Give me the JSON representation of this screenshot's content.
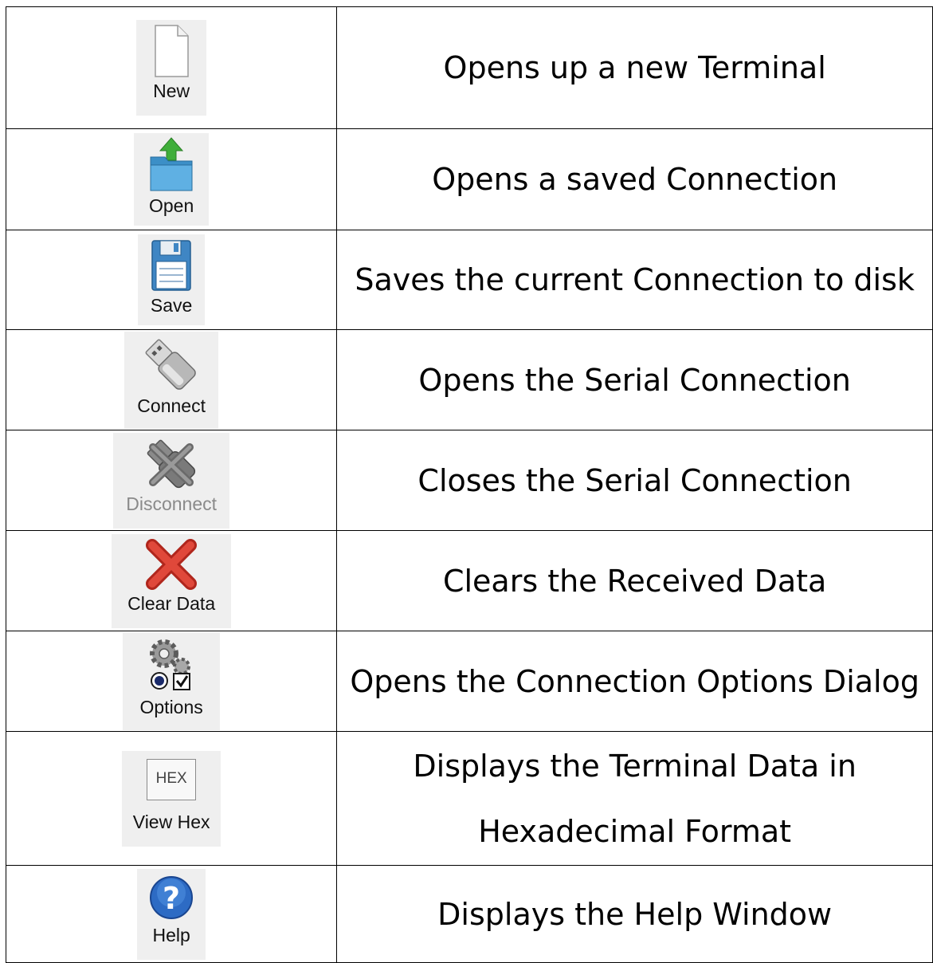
{
  "rows": [
    {
      "button": "New",
      "icon": "new-file-icon",
      "description": "Opens up a new Terminal"
    },
    {
      "button": "Open",
      "icon": "open-folder-icon",
      "description": "Opens a saved Connection"
    },
    {
      "button": "Save",
      "icon": "floppy-disk-icon",
      "description": "Saves the current Connection to disk"
    },
    {
      "button": "Connect",
      "icon": "usb-plug-icon",
      "description": "Opens the Serial Connection"
    },
    {
      "button": "Disconnect",
      "icon": "usb-unplug-icon",
      "description": "Closes the Serial Connection"
    },
    {
      "button": "Clear Data",
      "icon": "red-x-icon",
      "description": "Clears the Received Data"
    },
    {
      "button": "Options",
      "icon": "gear-check-icon",
      "description": "Opens the Connection Options Dialog"
    },
    {
      "button": "View Hex",
      "icon": "hex-icon",
      "icon_text": "HEX",
      "description_lines": [
        "Displays the Terminal Data in",
        "Hexadecimal Format"
      ]
    },
    {
      "button": "Help",
      "icon": "question-icon",
      "description": "Displays the Help Window"
    }
  ]
}
